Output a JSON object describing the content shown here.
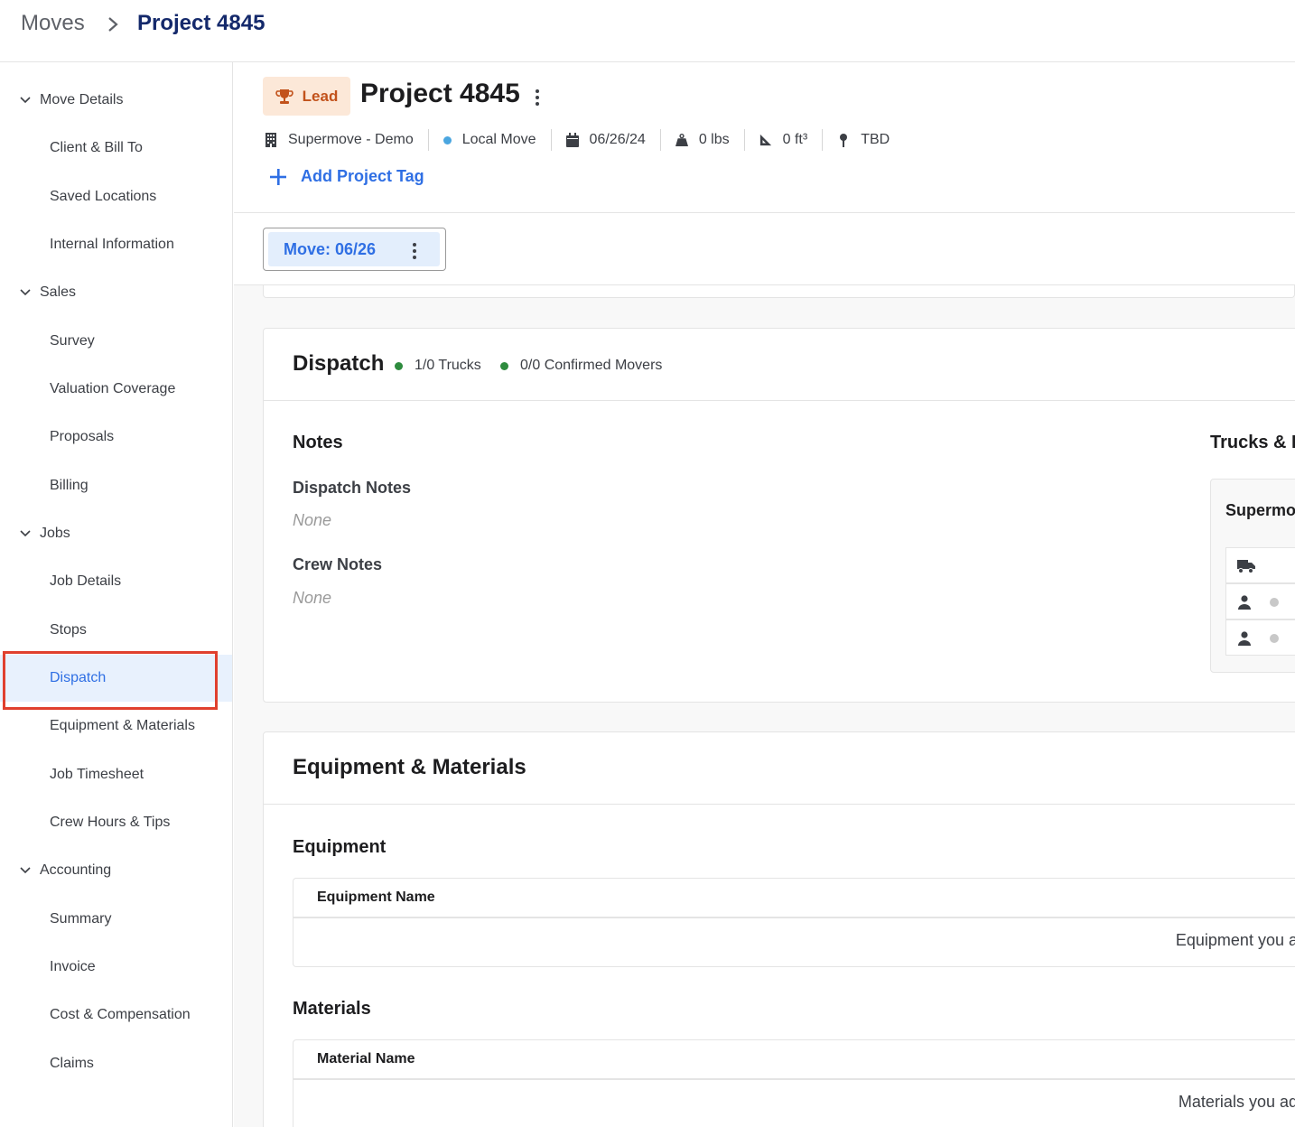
{
  "breadcrumb": {
    "root": "Moves",
    "current": "Project 4845"
  },
  "sidebar": {
    "groups": [
      {
        "label": "Move Details",
        "items": [
          "Client & Bill To",
          "Saved Locations",
          "Internal Information"
        ]
      },
      {
        "label": "Sales",
        "items": [
          "Survey",
          "Valuation Coverage",
          "Proposals",
          "Billing"
        ]
      },
      {
        "label": "Jobs",
        "items": [
          "Job Details",
          "Stops",
          "Dispatch",
          "Equipment & Materials",
          "Job Timesheet",
          "Crew Hours & Tips"
        ]
      },
      {
        "label": "Accounting",
        "items": [
          "Summary",
          "Invoice",
          "Cost & Compensation",
          "Claims"
        ]
      }
    ],
    "active": "Dispatch"
  },
  "project": {
    "status": "Lead",
    "title": "Project 4845",
    "meta": {
      "organization": "Supermove - Demo",
      "move_type": "Local Move",
      "date": "06/26/24",
      "weight": "0 lbs",
      "volume": "0 ft³",
      "location": "TBD"
    },
    "add_tag_label": "Add Project Tag"
  },
  "tabs": {
    "move_label": "Move: 06/26"
  },
  "dispatch": {
    "title": "Dispatch",
    "trucks_stat": "1/0 Trucks",
    "movers_stat": "0/0 Confirmed Movers",
    "notes_title": "Notes",
    "dispatch_notes_label": "Dispatch Notes",
    "dispatch_notes_value": "None",
    "crew_notes_label": "Crew Notes",
    "crew_notes_value": "None",
    "trucks_title": "Trucks & I",
    "company": "Supermo"
  },
  "equipment": {
    "title": "Equipment & Materials",
    "equipment_title": "Equipment",
    "equipment_col": "Equipment Name",
    "equipment_empty": "Equipment you ad",
    "materials_title": "Materials",
    "materials_col": "Material Name",
    "materials_empty": "Materials you add"
  },
  "colors": {
    "brand_navy": "#14296b",
    "link_blue": "#2f6fe4",
    "lead_orange": "#c2521b",
    "status_green": "#2e8b3e",
    "highlight_red": "#e0402e"
  }
}
